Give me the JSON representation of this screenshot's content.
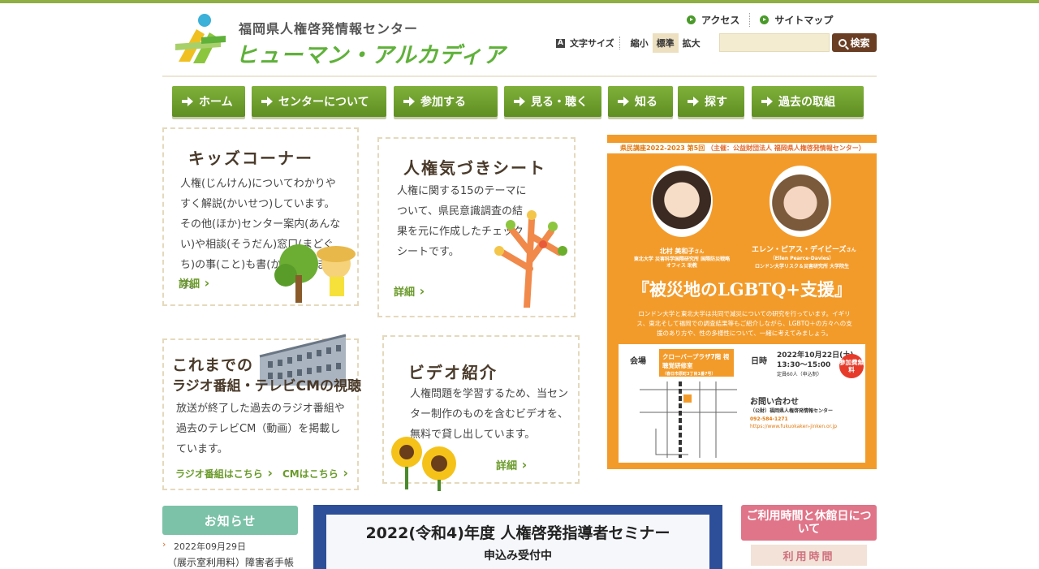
{
  "header": {
    "logo_subtitle": "福岡県人権啓発情報センター",
    "logo_title": "ヒューマン・アルカディア",
    "links": [
      "アクセス",
      "サイトマップ"
    ],
    "fontsize_icon": "A",
    "fontsize_label": "文字サイズ",
    "fontsize_options": [
      "縮小",
      "標準",
      "拡大"
    ],
    "fontsize_active": "標準",
    "search_placeholder": "",
    "search_button": "検索"
  },
  "nav": [
    "ホーム",
    "センターについて",
    "参加する",
    "見る・聴く",
    "知る",
    "探す",
    "過去の取組"
  ],
  "cards": {
    "kids": {
      "title": "キッズコーナー",
      "text": "人権(じんけん)についてわかりやすく解説(かいせつ)しています。その他(ほか)センター案内(あんない)や相談(そうだん)窓口(まどぐち)の事(こと)も書(か)いています。",
      "detail": "詳細"
    },
    "sheet": {
      "title": "人権気づきシート",
      "text": "人権に関する15のテーマについて、県民意識調査の結果を元に作成したチェックシートです。",
      "detail": "詳細"
    },
    "radio": {
      "title_line1": "これまでの",
      "title_line2": "ラジオ番組・テレビCMの視聴",
      "text": "放送が終了した過去のラジオ番組や過去のテレビCM（動画）を掲載しています。",
      "link_radio": "ラジオ番組はこちら",
      "link_cm": "CMはこちら"
    },
    "video": {
      "title": "ビデオ紹介",
      "text": "人権問題を学習するため、当センター制作のものを含むビデオを、無料で貸し出しています。",
      "detail": "詳細"
    }
  },
  "poster": {
    "header": "県民講座2022-2023 第5回",
    "header_org": "（主催：公益財団法人 福岡県人権啓発情報センター）",
    "speaker1_name": "北村 美和子",
    "speaker1_aff": "東北大学 災害科学国際研究所 国際防災戦略オフィス 助教",
    "speaker2_name": "エレン・ピアス・デイビーズ",
    "speaker2_en": "（Ellen Pearce-Davies）",
    "speaker2_aff": "ロンドン大学リスク＆災害研究所 大学院生",
    "honorific": "さん",
    "title": "『被災地のLGBTQ+支援』",
    "desc": "ロンドン大学と東北大学は共同で減災についての研究を行っています。イギリス、東北そして福岡での調査結果等もご紹介しながら、LGBTQ＋の方々への支援のあり方や、性の多様性について、一緒に考えてみましょう。",
    "venue_label": "会場",
    "venue": "クローバープラザ7階 視聴覚研修室",
    "venue_addr": "（春日市原町3丁目1番7号）",
    "date_label": "日時",
    "date": "2022年10月22日(土)",
    "time": "13:30〜15:00",
    "capacity": "定員60人（申込制）",
    "badge": "参加費無料",
    "contact_label": "お問い合わせ",
    "contact_org": "（公財）福岡県人権啓発情報センター",
    "tel": "092-584-1271",
    "url": "https://www.fukuokaken-jinken.or.jp"
  },
  "notice": {
    "heading": "お知らせ",
    "date": "2022年09月29日",
    "text": "（展示室利用料）障害者手帳"
  },
  "banner": {
    "title": "2022(令和4)年度 人権啓発指導者セミナー",
    "subtitle": "申込み受付中"
  },
  "hours": {
    "heading": "ご利用時間と休館日について",
    "sub": "利用時間"
  },
  "colors": {
    "nav_green": "#6f9e2c",
    "poster_orange": "#f39b2a",
    "notice_teal": "#7cc2a8",
    "hours_pink": "#e07488",
    "search_brown": "#6a3e23"
  }
}
